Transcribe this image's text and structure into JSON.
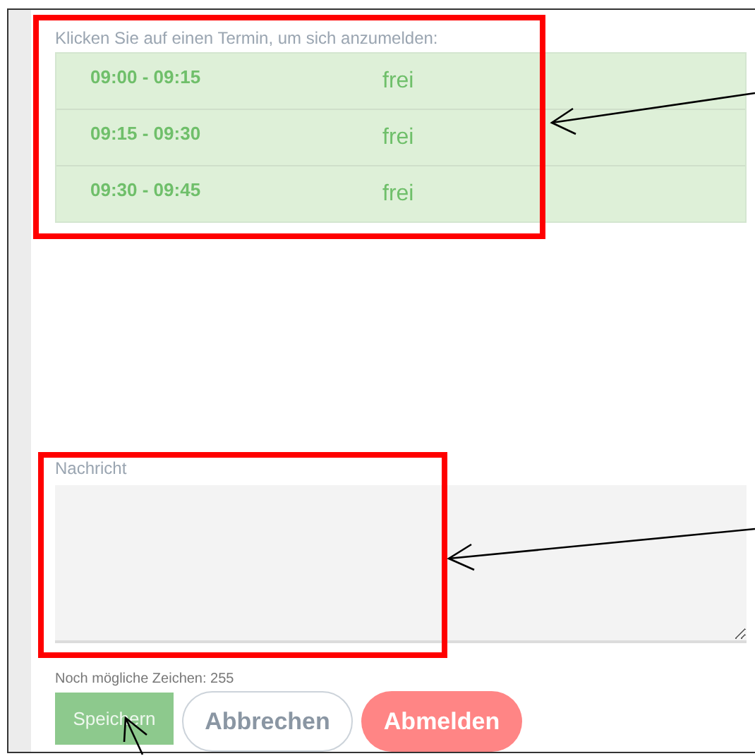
{
  "instruction": "Klicken Sie auf einen Termin, um sich anzumelden:",
  "slots": [
    {
      "time": "09:00 - 09:15",
      "status": "frei"
    },
    {
      "time": "09:15 - 09:30",
      "status": "frei"
    },
    {
      "time": "09:30 - 09:45",
      "status": "frei"
    }
  ],
  "message": {
    "label": "Nachricht"
  },
  "counter": "Noch mögliche Zeichen: 255",
  "buttons": [
    {
      "label": "Speichern",
      "kind": "save"
    },
    {
      "label": "Abbrechen",
      "kind": "cancel"
    },
    {
      "label": "Abmelden",
      "kind": "signout"
    }
  ]
}
